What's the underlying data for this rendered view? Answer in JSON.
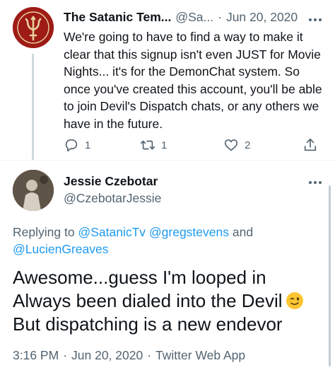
{
  "tweet1": {
    "author_name": "The Satanic Tem...",
    "author_handle": "@Sa...",
    "separator": "·",
    "date": "Jun 20, 2020",
    "text": "We're going to have to find a way to make it clear that this signup isn't even JUST for Movie Nights... it's for the DemonChat system. So once you've created this account, you'll be able to join Devil's Dispatch chats, or any others we have in the future.",
    "replies": "1",
    "retweets": "1",
    "likes": "2",
    "avatar_icon": "trident-logo-icon",
    "avatar_color": "#9e1b16"
  },
  "tweet2": {
    "author_name": "Jessie Czebotar",
    "author_handle": "@CzebotarJessie",
    "replying_prefix": "Replying to",
    "mention1": "@SatanicTv",
    "mention2": "@gregstevens",
    "and_word": "and",
    "mention3": "@LucienGreaves",
    "line1": "Awesome...guess I'm looped in",
    "line2": "Always been dialed into the Devil",
    "line3": "But dispatching is a new endevor",
    "emoji": "winking-face-icon",
    "time": "3:16 PM",
    "separator": "·",
    "date": "Jun 20, 2020",
    "app": "Twitter Web App"
  },
  "colors": {
    "text": "#0f1419",
    "secondary": "#536471",
    "link": "#1d9bf0",
    "divider": "#eff3f4"
  }
}
